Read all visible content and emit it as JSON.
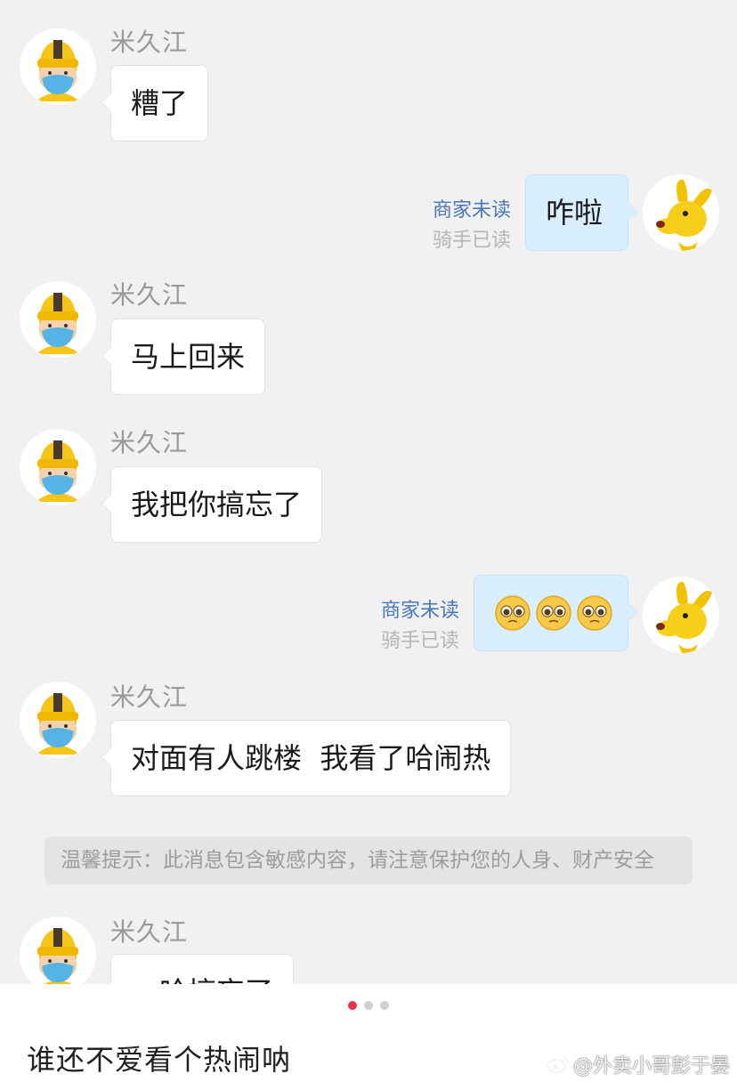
{
  "conversation": {
    "rider_name": "米久江",
    "messages": [
      {
        "from": "rider",
        "text": "糟了"
      },
      {
        "from": "user",
        "text": "咋啦",
        "status_merchant": "商家未读",
        "status_rider": "骑手已读"
      },
      {
        "from": "rider",
        "text": "马上回来"
      },
      {
        "from": "rider",
        "text": "我把你搞忘了"
      },
      {
        "from": "user",
        "emoji": "pleading-face-icon x3",
        "status_merchant": "商家未读",
        "status_rider": "骑手已读"
      },
      {
        "from": "rider",
        "text": "对面有人跳楼  我看了哈闹热"
      },
      {
        "from": "rider",
        "text": "哈搞忘了"
      }
    ],
    "notice": "温馨提示：此消息包含敏感内容，请注意保护您的人身、财产安全"
  },
  "carousel": {
    "pages": 3,
    "active_index": 0
  },
  "post": {
    "caption": "谁还不爱看个热闹呐",
    "watermark": "@外卖小哥彭于晏"
  },
  "colors": {
    "chat_bg": "#f1f1f2",
    "outgoing_bubble": "#d9efff",
    "merchant_status": "#4a78b8",
    "active_dot": "#e8334a"
  }
}
